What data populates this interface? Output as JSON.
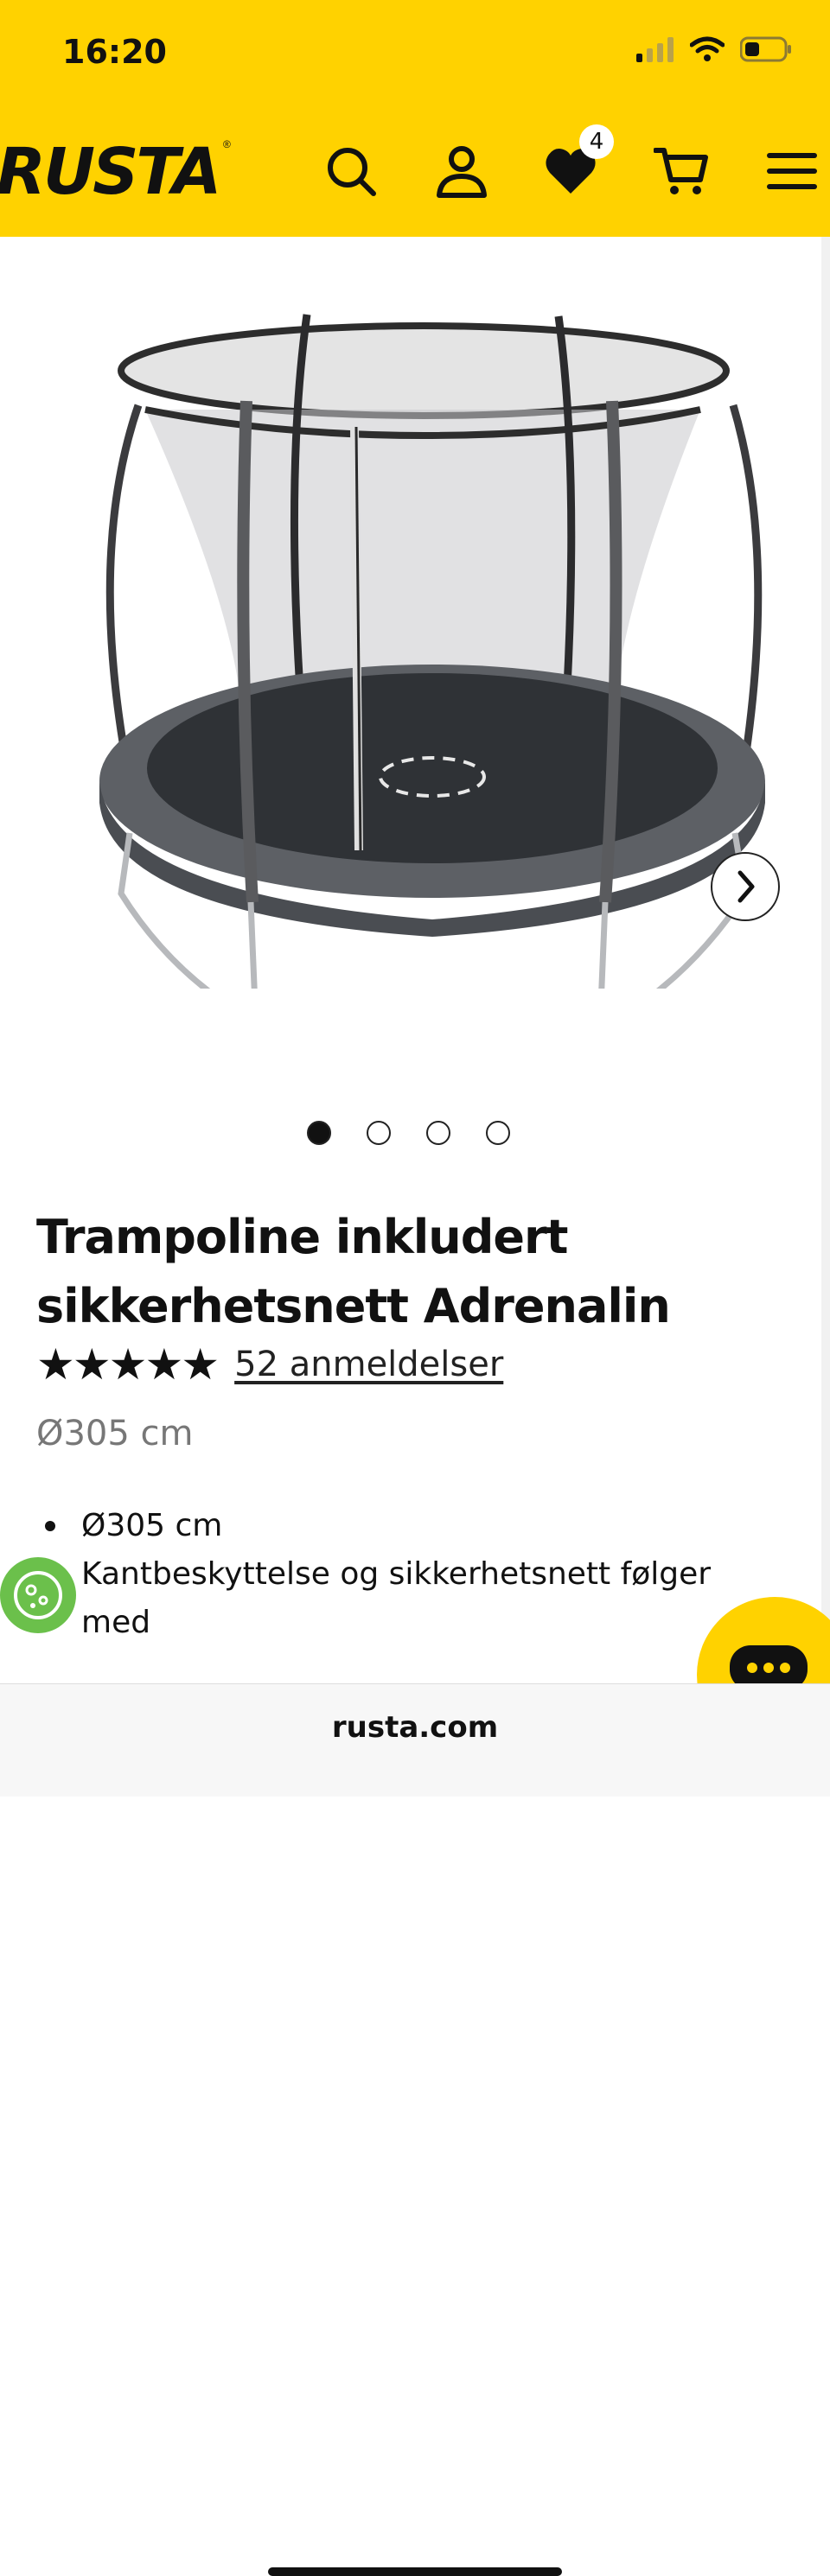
{
  "status_bar": {
    "time": "16:20"
  },
  "header": {
    "logo_text": "RUSTA",
    "wishlist_count": "4",
    "icons": [
      "search-icon",
      "account-icon",
      "wishlist-heart-icon",
      "cart-icon",
      "menu-icon"
    ]
  },
  "gallery": {
    "image_count": 4,
    "active_index": 0
  },
  "product": {
    "title": "Trampoline inkludert sikkerhetsnett Adrenalin",
    "rating": 4.7,
    "stars": "★★★★★",
    "reviews_label": "52 anmeldelser",
    "variant": "Ø305 cm",
    "features": [
      "Ø305 cm",
      "Kantbeskyttelse og sikkerhetsnett følger med"
    ]
  },
  "browser": {
    "url": "rusta.com"
  },
  "colors": {
    "brand_yellow": "#ffd200",
    "cookie_green": "#6bc04b",
    "text": "#111111"
  }
}
